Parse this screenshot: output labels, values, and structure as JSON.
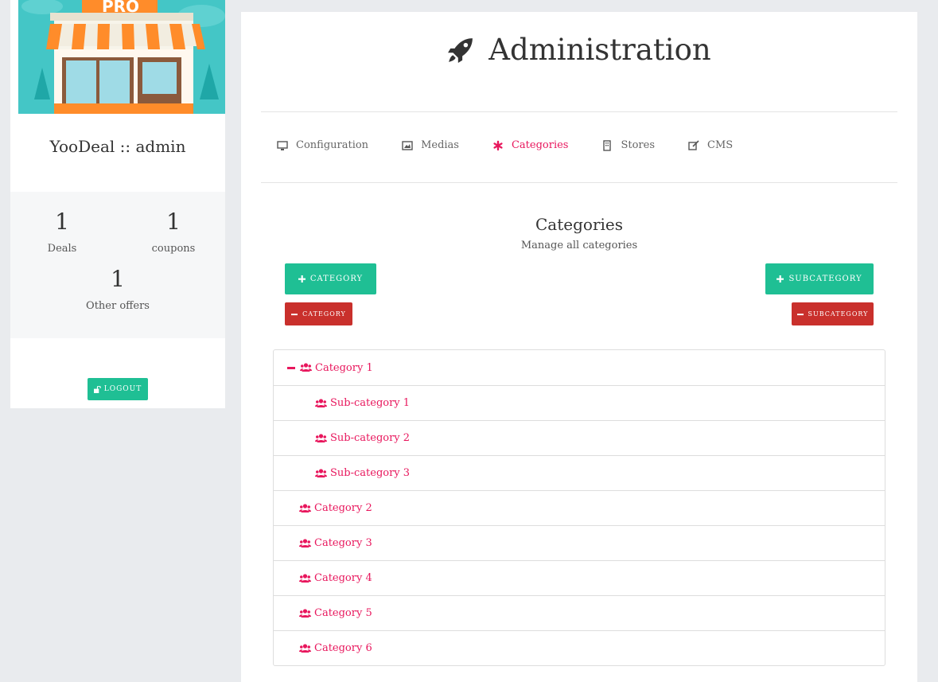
{
  "sidebar": {
    "profile_name": "YooDeal :: admin",
    "store_badge": "PRO",
    "stats": [
      {
        "value": "1",
        "label": "Deals"
      },
      {
        "value": "1",
        "label": "coupons"
      },
      {
        "value": "1",
        "label": "Other offers"
      }
    ],
    "logout_label": "LOGOUT"
  },
  "header": {
    "title": "Administration",
    "icon": "rocket-icon"
  },
  "tabs": [
    {
      "label": "Configuration",
      "icon": "desktop-icon",
      "active": false
    },
    {
      "label": "Medias",
      "icon": "image-icon",
      "active": false
    },
    {
      "label": "Categories",
      "icon": "asterisk-icon",
      "active": true
    },
    {
      "label": "Stores",
      "icon": "building-icon",
      "active": false
    },
    {
      "label": "CMS",
      "icon": "edit-icon",
      "active": false
    }
  ],
  "section": {
    "title": "Categories",
    "subtitle": "Manage all categories"
  },
  "buttons": {
    "add_category": "CATEGORY",
    "add_subcategory": "SUBCATEGORY",
    "remove_category": "CATEGORY",
    "remove_subcategory": "SUBCATEGORY"
  },
  "tree": [
    {
      "label": "Category 1",
      "level": 0,
      "expanded": true
    },
    {
      "label": "Sub-category 1",
      "level": 1
    },
    {
      "label": "Sub-category 2",
      "level": 1
    },
    {
      "label": "Sub-category 3",
      "level": 1
    },
    {
      "label": "Category 2",
      "level": 0
    },
    {
      "label": "Category 3",
      "level": 0
    },
    {
      "label": "Category 4",
      "level": 0
    },
    {
      "label": "Category 5",
      "level": 0
    },
    {
      "label": "Category 6",
      "level": 0
    }
  ],
  "colors": {
    "accent": "#e8175d",
    "green": "#1fbf94",
    "red": "#c9302c",
    "background": "#e9ebee"
  }
}
